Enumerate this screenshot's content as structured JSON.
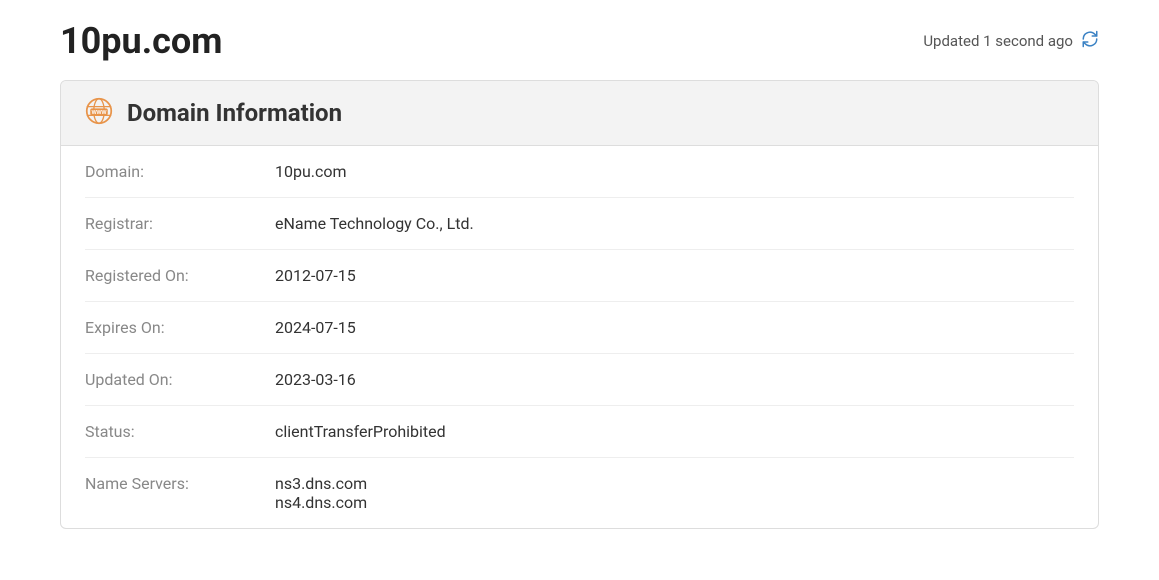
{
  "header": {
    "title": "10pu.com",
    "updated_text": "Updated 1 second ago"
  },
  "panel": {
    "heading": "Domain Information",
    "rows": [
      {
        "label": "Domain:",
        "value": "10pu.com"
      },
      {
        "label": "Registrar:",
        "value": "eName Technology Co., Ltd."
      },
      {
        "label": "Registered On:",
        "value": "2012-07-15"
      },
      {
        "label": "Expires On:",
        "value": "2024-07-15"
      },
      {
        "label": "Updated On:",
        "value": "2023-03-16"
      },
      {
        "label": "Status:",
        "value": "clientTransferProhibited"
      },
      {
        "label": "Name Servers:",
        "value": "ns3.dns.com\nns4.dns.com"
      }
    ]
  }
}
